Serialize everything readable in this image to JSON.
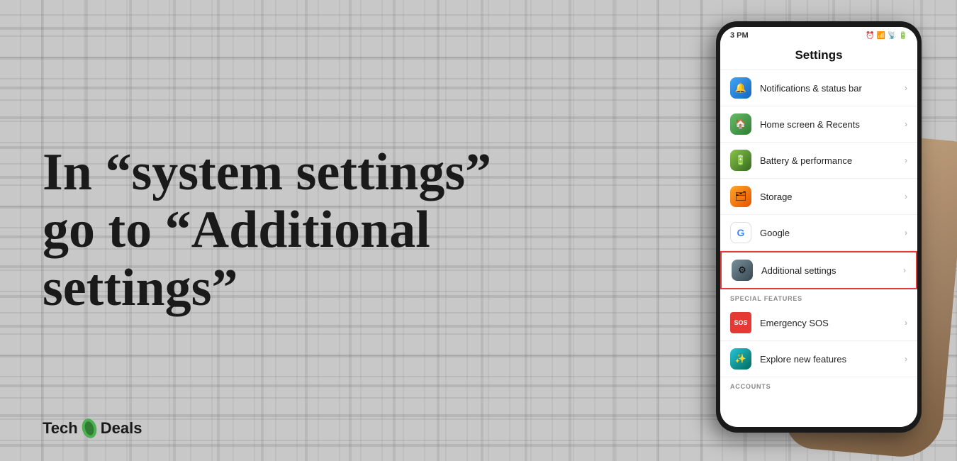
{
  "background": {
    "color": "#c2c2c2"
  },
  "left_text": {
    "heading": "In “system settings” go to “Additional settings”"
  },
  "brand": {
    "tech": "Tech",
    "deals": "Deals"
  },
  "phone": {
    "status_bar": {
      "time": "3 PM",
      "icons": "📶🔋"
    },
    "settings_title": "Settings",
    "items": [
      {
        "icon_class": "icon-blue",
        "icon_symbol": "🔔",
        "label": "Notifications & status bar",
        "highlighted": false
      },
      {
        "icon_class": "icon-green-dark",
        "icon_symbol": "🏠",
        "label": "Home screen & Recents",
        "highlighted": false
      },
      {
        "icon_class": "icon-green",
        "icon_symbol": "🔋",
        "label": "Battery & performance",
        "highlighted": false
      },
      {
        "icon_class": "icon-orange",
        "icon_symbol": "💾",
        "label": "Storage",
        "highlighted": false
      },
      {
        "icon_class": "icon-google",
        "icon_symbol": "G",
        "label": "Google",
        "highlighted": false
      },
      {
        "icon_class": "icon-gray",
        "icon_symbol": "⚙",
        "label": "Additional settings",
        "highlighted": true
      }
    ],
    "special_features_label": "SPECIAL FEATURES",
    "special_items": [
      {
        "icon_class": "icon-red-badge",
        "icon_symbol": "SOS",
        "label": "Emergency SOS",
        "highlighted": false
      },
      {
        "icon_class": "icon-teal",
        "icon_symbol": "✨",
        "label": "Explore new features",
        "highlighted": false
      }
    ],
    "accounts_label": "ACCOUNTS"
  }
}
